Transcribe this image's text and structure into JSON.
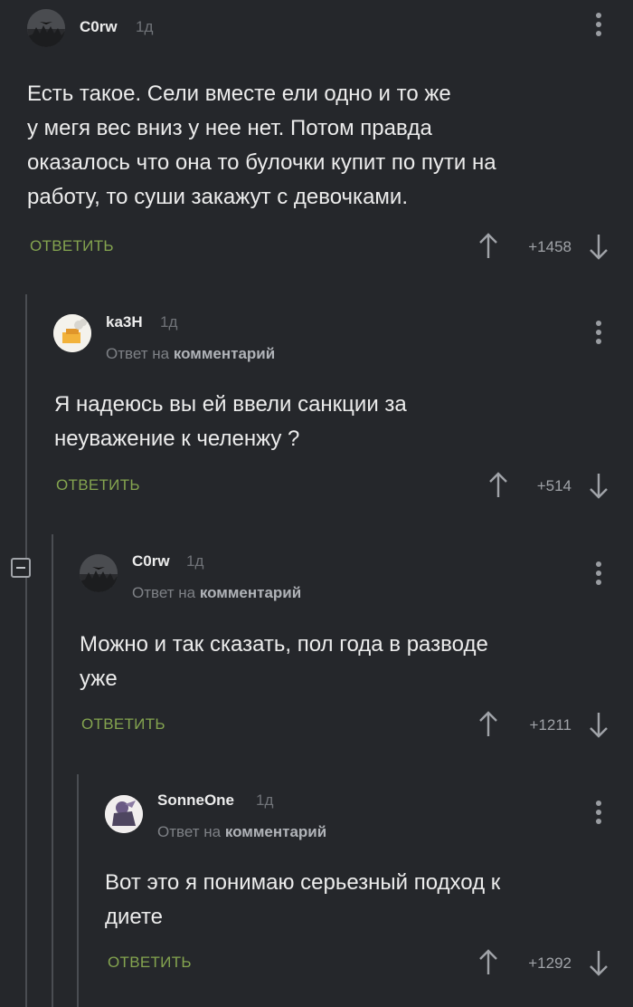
{
  "colors": {
    "background": "#25272b",
    "accent": "#84a44f",
    "thread_line": "#4a4d52"
  },
  "comments": [
    {
      "username": "C0rw",
      "time": "1д",
      "reply_prefix": "",
      "reply_target": "",
      "lines": [
        "Есть такое. Сели вместе ели одно и то же",
        "у мегя вес вниз у нее нет. Потом правда",
        "оказалось что она то булочки купит по пути на",
        "работу, то суши закажут с девочками."
      ],
      "reply_label": "ОТВЕТИТЬ",
      "rating": "+1458"
    },
    {
      "username": "ka3H",
      "time": "1д",
      "reply_prefix": "Ответ на",
      "reply_target": "комментарий",
      "lines": [
        "Я надеюсь вы ей ввели санкции за",
        "неуважение к челенжу ?"
      ],
      "reply_label": "ОТВЕТИТЬ",
      "rating": "+514"
    },
    {
      "username": "C0rw",
      "time": "1д",
      "reply_prefix": "Ответ на",
      "reply_target": "комментарий",
      "lines": [
        "Можно и так сказать, пол года в разводе",
        "уже"
      ],
      "reply_label": "ОТВЕТИТЬ",
      "rating": "+1211"
    },
    {
      "username": "SonneOne",
      "time": "1д",
      "reply_prefix": "Ответ на",
      "reply_target": "комментарий",
      "lines": [
        "Вот это я понимаю серьезный подход к",
        "диете"
      ],
      "reply_label": "ОТВЕТИТЬ",
      "rating": "+1292"
    }
  ]
}
